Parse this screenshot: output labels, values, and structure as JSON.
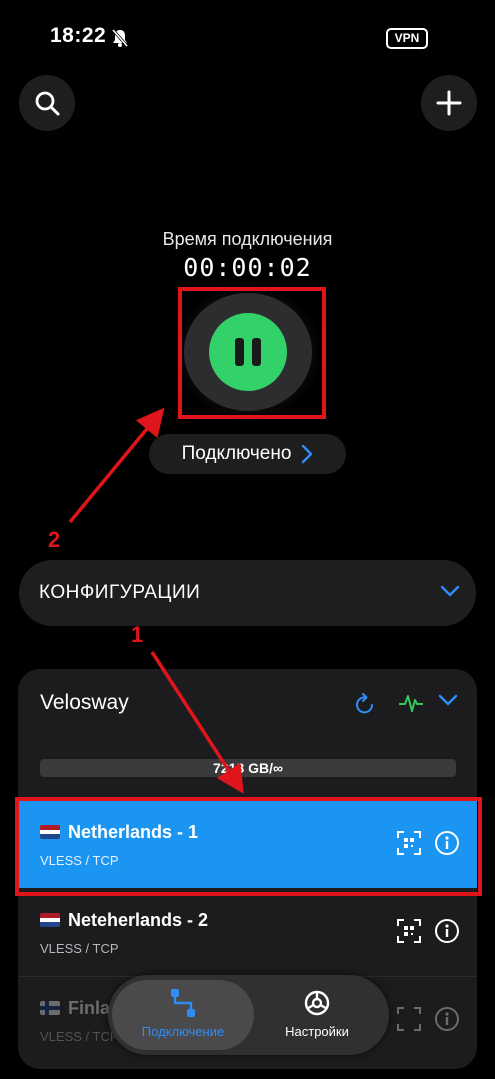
{
  "status_bar": {
    "time": "18:22",
    "vpn_label": "VPN"
  },
  "timer": {
    "label": "Время подключения",
    "value": "00:00:02"
  },
  "status": {
    "label": "Подключено"
  },
  "configs": {
    "title": "КОНФИГУРАЦИИ"
  },
  "group": {
    "name": "Velosway",
    "traffic": "7218 GB/∞",
    "servers": [
      {
        "name": "Netherlands - 1",
        "protocol": "VLESS / TCP",
        "flag": "nl",
        "selected": true
      },
      {
        "name": "Neteherlands - 2",
        "protocol": "VLESS / TCP",
        "flag": "nl",
        "selected": false
      },
      {
        "name": "Finla",
        "protocol": "VLESS / TCP",
        "flag": "fi",
        "selected": false
      }
    ]
  },
  "nav": {
    "connection_label": "Подключение",
    "settings_label": "Настройки"
  },
  "annotations": {
    "one": "1",
    "two": "2"
  },
  "colors": {
    "accent": "#2f8df5",
    "connected": "#33d16a",
    "selected_row": "#1b95f2",
    "annotation": "#e0141b"
  }
}
